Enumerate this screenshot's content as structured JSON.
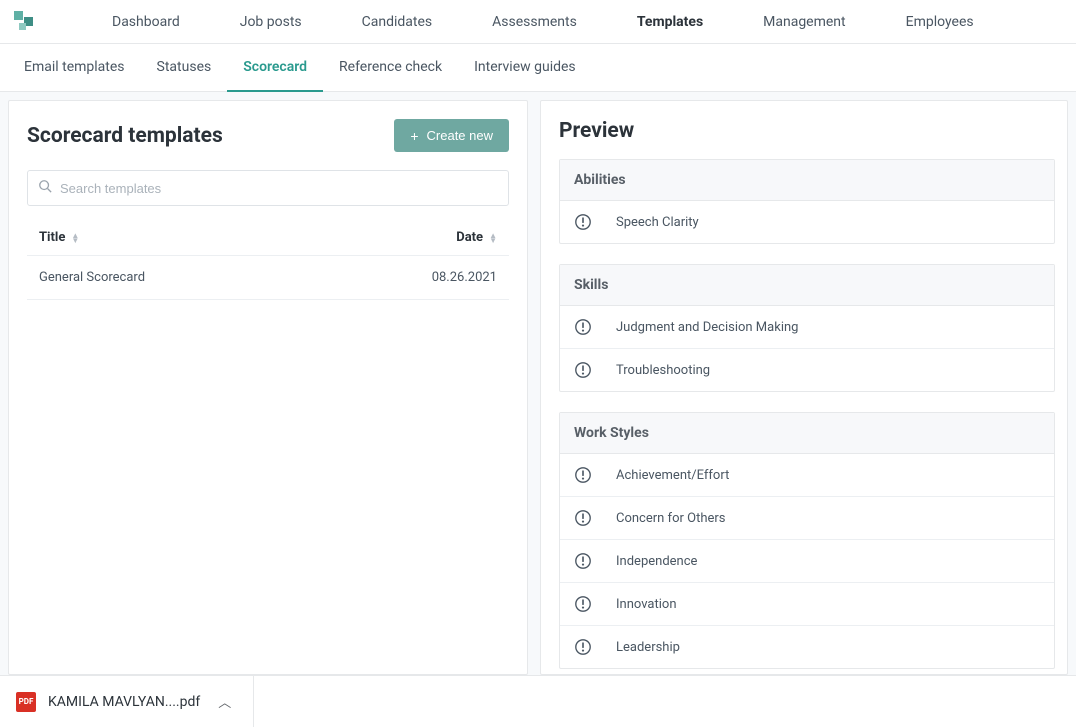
{
  "topnav": {
    "items": [
      {
        "label": "Dashboard"
      },
      {
        "label": "Job posts"
      },
      {
        "label": "Candidates"
      },
      {
        "label": "Assessments"
      },
      {
        "label": "Templates",
        "active": true
      },
      {
        "label": "Management"
      },
      {
        "label": "Employees"
      }
    ]
  },
  "subnav": {
    "items": [
      {
        "label": "Email templates"
      },
      {
        "label": "Statuses"
      },
      {
        "label": "Scorecard",
        "active": true
      },
      {
        "label": "Reference check"
      },
      {
        "label": "Interview guides"
      }
    ]
  },
  "left": {
    "title": "Scorecard templates",
    "create_label": "Create new",
    "search_placeholder": "Search templates",
    "th_title": "Title",
    "th_date": "Date",
    "rows": [
      {
        "title": "General Scorecard",
        "date": "08.26.2021"
      }
    ]
  },
  "preview": {
    "title": "Preview",
    "groups": [
      {
        "name": "Abilities",
        "items": [
          "Speech Clarity"
        ]
      },
      {
        "name": "Skills",
        "items": [
          "Judgment and Decision Making",
          "Troubleshooting"
        ]
      },
      {
        "name": "Work Styles",
        "items": [
          "Achievement/Effort",
          "Concern for Others",
          "Independence",
          "Innovation",
          "Leadership"
        ]
      }
    ]
  },
  "download": {
    "filename": "KAMILA MAVLYAN....pdf",
    "badge": "PDF"
  }
}
